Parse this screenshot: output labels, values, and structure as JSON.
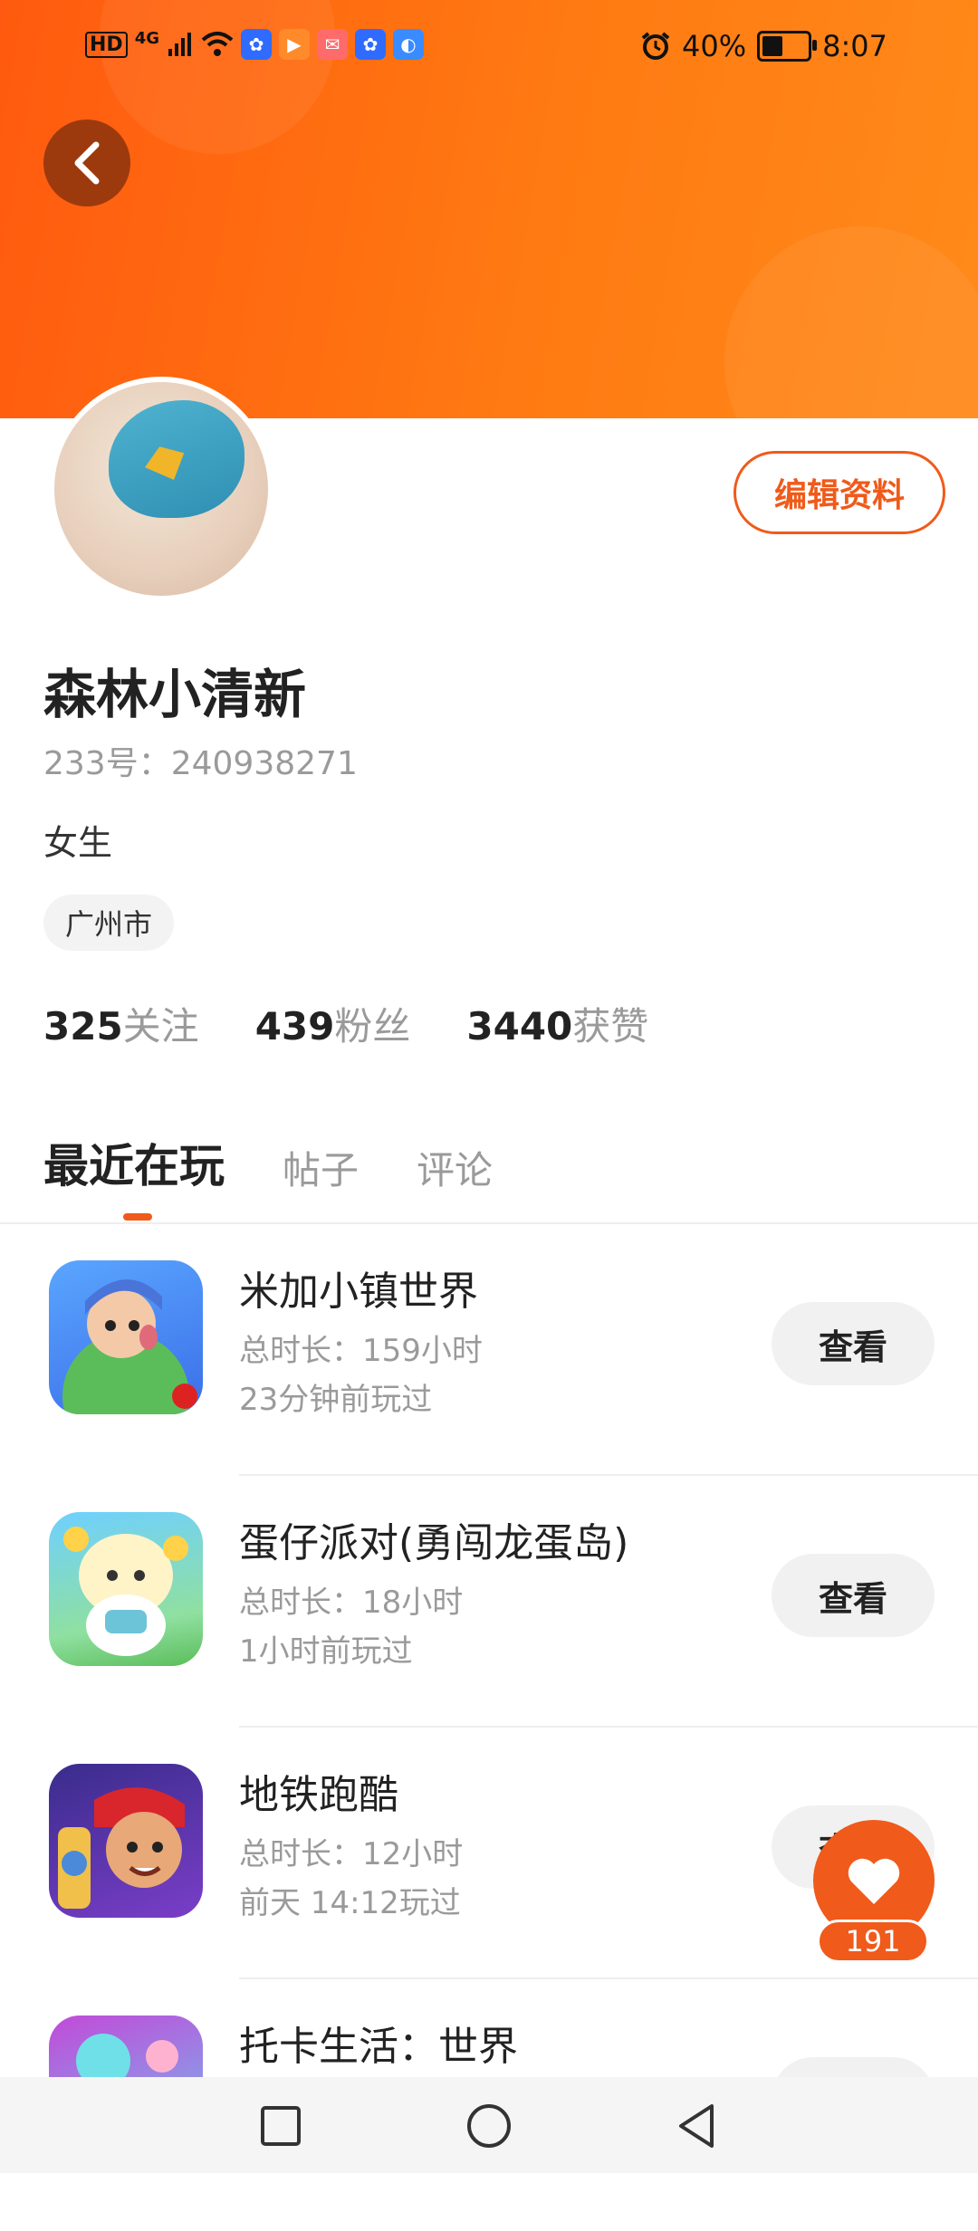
{
  "status_bar": {
    "network_hd": "HD",
    "network_4g": "4G",
    "battery": "40%",
    "time": "8:07"
  },
  "profile": {
    "name": "森林小清新",
    "uid": "233号：240938271",
    "gender": "女生",
    "city": "广州市",
    "edit_label": "编辑资料"
  },
  "stats": {
    "following_count": "325",
    "following_label": "关注",
    "fans_count": "439",
    "fans_label": "粉丝",
    "likes_count": "3440",
    "likes_label": "获赞"
  },
  "tabs": [
    {
      "label": "最近在玩",
      "active": true
    },
    {
      "label": "帖子",
      "active": false
    },
    {
      "label": "评论",
      "active": false
    }
  ],
  "games": [
    {
      "title": "米加小镇世界",
      "duration": "总时长：159小时",
      "last_played": "23分钟前玩过",
      "button": "查看"
    },
    {
      "title": "蛋仔派对(勇闯龙蛋岛)",
      "duration": "总时长：18小时",
      "last_played": "1小时前玩过",
      "button": "查看"
    },
    {
      "title": "地铁跑酷",
      "duration": "总时长：12小时",
      "last_played": "前天 14:12玩过",
      "button": "查看"
    },
    {
      "title": "托卡生活：世界",
      "duration": "",
      "last_played": "",
      "button": ""
    }
  ],
  "like_count": "191",
  "colors": {
    "accent": "#f05a1a",
    "header_start": "#ff5a0f",
    "header_end": "#ff8a1a"
  },
  "icons": [
    "back-arrow-icon",
    "heart-icon",
    "nav-square-icon",
    "nav-circle-icon",
    "nav-triangle-icon"
  ]
}
